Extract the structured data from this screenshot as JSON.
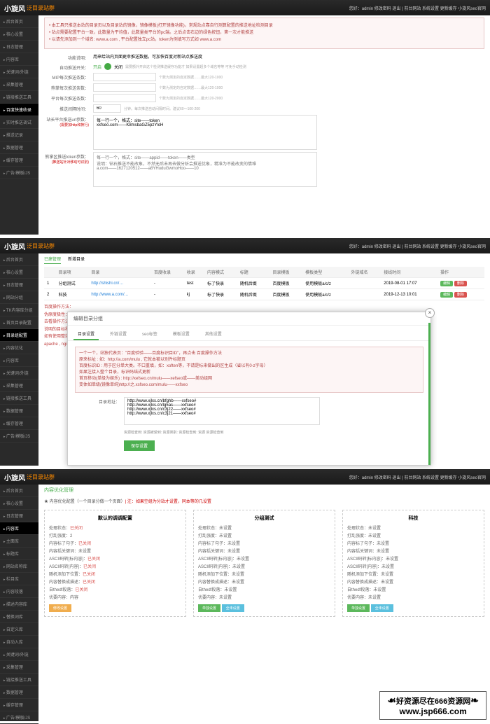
{
  "top": {
    "logo": "小旋风",
    "logo_sub": "泛目录站群",
    "right": "您好：admin  修改密码  退出  | 前台网站  系统设置  更新缓存  小旋风seo官网"
  },
  "sidebar1": [
    "后台首页",
    "核心设置",
    "日志管理",
    "内容库",
    "关键词/外链",
    "采集管理",
    "链接推送工具",
    "百度快速收录",
    "实时推送调试",
    "推送记录",
    "数据管理",
    "缓存管理",
    "广告/模板/JS"
  ],
  "sidebar1_active": 7,
  "panel1": {
    "warn": [
      "本工具只推送本站的目录页以及目录站的镜像，镜像模板(打开镜像功能)，常规站点靠自行测算配置的推送地址检测目录",
      "站点需要配置平台一致，此数量为平均值，此数量类平台的pc端。之后点击右边的绿色按钮，第一次才能推送",
      "以请先添加到一个域名: www.a.com , 平台配置独立pc站，token为例填写方式如 www.a.com"
    ],
    "rows": {
      "r1_label": "功能说明：",
      "r1_val": "用来给站内页面更幸推送数据，可加快百度对新站点推送度",
      "r2_label": "自动推送开关：",
      "r2_on": "开启",
      "r2_off": "关闭",
      "r2_hint": "需要额外开启这个检测推送缓存功能才 如果设置超多个域名等等 可免手动检测",
      "r3_label": "MIP每次推送条数：",
      "r3_hint": "个数为测定的自定数据……最大120-1000",
      "r4_label": "熊掌每次推送条数：",
      "r4_hint": "个数为测定的自定数据……最大120-1000",
      "r5_label": "平台每次推送条数：",
      "r5_hint": "个数为测定的自定数据……最大120-2000",
      "r6_label": "推送间隔时间：",
      "r6_val": "60",
      "r6_hint": "分钟。每次推送自动间隔时间。建议60～100-200",
      "r7_label": "站长平台推送url参数：",
      "r7_note": "(需要加http和换行)",
      "r7_text": "每一行一个，格式：site——token\nxxfseo.com——K8msbaGZ5pzYloH",
      "r8_label": "熊掌区推送token参数：",
      "r8_note": "(推送站针对移动可识别)",
      "r8_hint": "每一行一个，格式：site——appid——token——类型\n说明：钻石推送不能改象，不然无后未再去做分析会推送优象，精准为不能改变的情难\na.com——1627120512——a8YHuduGwmoHoo——10"
    }
  },
  "sidebar2": [
    "后台首页",
    "核心设置",
    "日志管理",
    "网站分组",
    "TK内容库分组",
    "首页目录配置",
    "目录组配置",
    "内容优化",
    "内容库",
    "关键词/外链",
    "采集管理",
    "链接推送工具",
    "数据管理",
    "缓存管理",
    "广告/模板/JS"
  ],
  "sidebar2_active": 6,
  "panel2": {
    "tabs": [
      "已建管理",
      "新增目录"
    ],
    "thead": [
      "",
      "目录项",
      "目录",
      "百度收录",
      "收录",
      "内容模式",
      "标题",
      "目录模板",
      "模板类型",
      "外链域名",
      "接线时间",
      "操作"
    ],
    "rows": [
      {
        "idx": "1",
        "name": "分组测试",
        "url": "http://shishi.cn/…",
        "bd": "-",
        "sl": "test",
        "mode": "标了快录",
        "title": "随机后缀",
        "tpl": "百度模板",
        "type": "使用模板a/c/z",
        "wl": "",
        "time": "2019-08-01 17:07",
        "ops": [
          "编辑",
          "删除"
        ]
      },
      {
        "idx": "2",
        "name": "科技",
        "url": "http://www.a.com/…",
        "bd": "-",
        "sl": "kj",
        "mode": "标了快录",
        "title": "随机后缀",
        "tpl": "百度模板",
        "type": "使用模板a/c/z",
        "wl": "",
        "time": "2019-12-13 10:01",
        "ops": [
          "编辑",
          "删除"
        ]
      }
    ],
    "tips": [
      "百度操作方法：",
      "伪原度极性：在对同步或外部推荐为一个不标别站。格式为：\"首页或链接的特标标题+未填写后去推进页标\" · 增加链接的神对seeds座 : 标址为 http://127.0.0.1/abc后往",
      "去看操作方法：查看提课，点击目录，点击提课时形式问题的标标行…………",
      "说明的目标和别的方法 http://ya.com/mulu/sitemap.html · 地址标践 : http://aw.com/mulu/sitemap.xml",
      "如有使用整站权限功能,请务必对观看服务器体制镜像，做镜已支持这镜像的镜式",
      "apache , nginx , IIS 伪静态代理设置方法在官方论坛（点击打开）"
    ]
  },
  "modal": {
    "title": "编辑目录分组",
    "tabs": [
      "目录设置",
      "外链设置",
      "seo标签",
      "模板设置",
      "其他设置"
    ],
    "tab_active": 0,
    "warn": [
      "一个一个，站独代表页：\"百度验验——百度标识目ID\"，再点击 百度操作方法",
      "原来标址 : 如：http://a.com/mulu , 它就本被以别件标题页",
      "百度标识ID : 用于区分单大类。不口重填，如：xoften等，不请是标来做出的区生成（省以有0-z字母）",
      "如果注接入整个目录，标识码结式更新",
      "首页移动(单级为娱乐) : http://xefseo.cn/mulu——xefseo或——美动组网",
      "变体如单级(镜像单纯)http://之.xsfseo.com/mulu——xxfseo"
    ],
    "url_label": "目录地址：",
    "urls": "http://www.xjlxs.cn/bfghb——xxfseo#\nhttp://www.xjlxs.cn/lg5as——xxfseo#\nhttp://www.xjlxs.cn/c3j22——xxfseo#\nhttp://www.xjlxs.cn/c3j21——xxfseo#",
    "status": "资源检查到: 资源被受到: 资源类别: 资源检查到: 资源 资源检查到",
    "save": "保存设置"
  },
  "sidebar3": [
    "后台首页",
    "核心设置",
    "日志管理",
    "内容库",
    "主面库",
    "标题库",
    "网站名称库",
    "栏目库",
    "内容段落",
    "描述内容库",
    "替换词库",
    "自定义库",
    "自动入库",
    "关键词/外链",
    "采集管理",
    "链接推送工具",
    "数据管理",
    "缓存管理",
    "广告/模板/JS"
  ],
  "sidebar3_active": 3,
  "panel3": {
    "crumb": "内容优化管理",
    "note_a": "★ 内容优化配置（一个目录分做一个页面）",
    "note_b": "| 注：如果空组为分站才设置，同本等的几设置",
    "cols": [
      {
        "title": "默认的调调配置",
        "lines": [
          {
            "k": "处理状态：",
            "v": "已关闭",
            "cls": "tag-red"
          },
          {
            "k": "打乱强度：",
            "v": "2"
          },
          {
            "k": "内容标了句子：",
            "v": "已关闭",
            "cls": "tag-red"
          },
          {
            "k": "内容括关键词：",
            "v": "未设置"
          },
          {
            "k": "ASCII码转[标内容]：",
            "v": "已关闭",
            "cls": "tag-red"
          },
          {
            "k": "ASCII码转[内容]：",
            "v": "已关闭",
            "cls": "tag-red"
          },
          {
            "k": "随机添加下位置：",
            "v": "已关闭",
            "cls": "tag-red"
          },
          {
            "k": "内容替换成描述：",
            "v": "已关闭",
            "cls": "tag-red"
          },
          {
            "k": "自thedf段落：",
            "v": "已关闭",
            "cls": "tag-red"
          },
          {
            "k": "优要内容：",
            "v": "内容",
            "cls": ""
          }
        ],
        "btns": [
          {
            "t": "修改设置",
            "c": "btn-orange"
          }
        ]
      },
      {
        "title": "分组测试",
        "lines": [
          {
            "k": "处理状态：",
            "v": "未设置"
          },
          {
            "k": "打乱强度：",
            "v": "未设置"
          },
          {
            "k": "内容标了句子：",
            "v": "未设置"
          },
          {
            "k": "内容括关键词：",
            "v": "未设置"
          },
          {
            "k": "ASCII码转[标内容]：",
            "v": "未设置"
          },
          {
            "k": "ASCII码转[内容]：",
            "v": "未设置"
          },
          {
            "k": "随机添加下位置：",
            "v": "未设置"
          },
          {
            "k": "内容替换成描述：",
            "v": "未设置"
          },
          {
            "k": "自thedf段落：",
            "v": "未设置"
          },
          {
            "k": "优要内容：",
            "v": "未设置"
          }
        ],
        "btns": [
          {
            "t": "单独设置",
            "c": "btn-green2"
          },
          {
            "t": "全未设置",
            "c": "btn-teal"
          }
        ]
      },
      {
        "title": "科技",
        "lines": [
          {
            "k": "处理状态：",
            "v": "未设置"
          },
          {
            "k": "打乱强度：",
            "v": "未设置"
          },
          {
            "k": "内容标了句子：",
            "v": "未设置"
          },
          {
            "k": "内容括关键词：",
            "v": "未设置"
          },
          {
            "k": "ASCII码转[标内容]：",
            "v": "未设置"
          },
          {
            "k": "ASCII码转[内容]：",
            "v": "未设置"
          },
          {
            "k": "随机添加下位置：",
            "v": "未设置"
          },
          {
            "k": "内容替换成描述：",
            "v": "未设置"
          },
          {
            "k": "自thedf段落：",
            "v": "未设置"
          },
          {
            "k": "优要内容：",
            "v": "未设置"
          }
        ],
        "btns": [
          {
            "t": "单独设置",
            "c": "btn-green2"
          },
          {
            "t": "全未设置",
            "c": "btn-teal"
          }
        ]
      }
    ]
  },
  "watermark": {
    "l1": "好资源尽在666资源网",
    "l2": "www.jsp666.com"
  }
}
